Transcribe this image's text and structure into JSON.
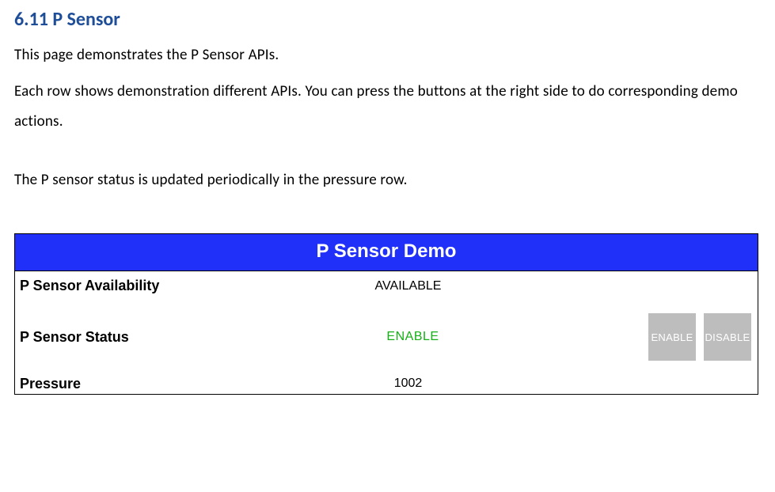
{
  "heading": "6.11 P Sensor",
  "intro_line_1": "This page demonstrates the P Sensor APIs.",
  "intro_line_2": "Each row shows demonstration different APIs. You can press the buttons at the right side to do corresponding demo actions.",
  "intro_line_3": "The P sensor status is updated periodically in the pressure row.",
  "demo": {
    "title": "P Sensor Demo",
    "availability": {
      "label": "P Sensor Availability",
      "value": "AVAILABLE"
    },
    "status": {
      "label": "P Sensor Status",
      "value": "ENABLE",
      "btn_enable": "ENABLE",
      "btn_disable": "DISABLE"
    },
    "pressure": {
      "label": "Pressure",
      "value": "1002"
    }
  }
}
